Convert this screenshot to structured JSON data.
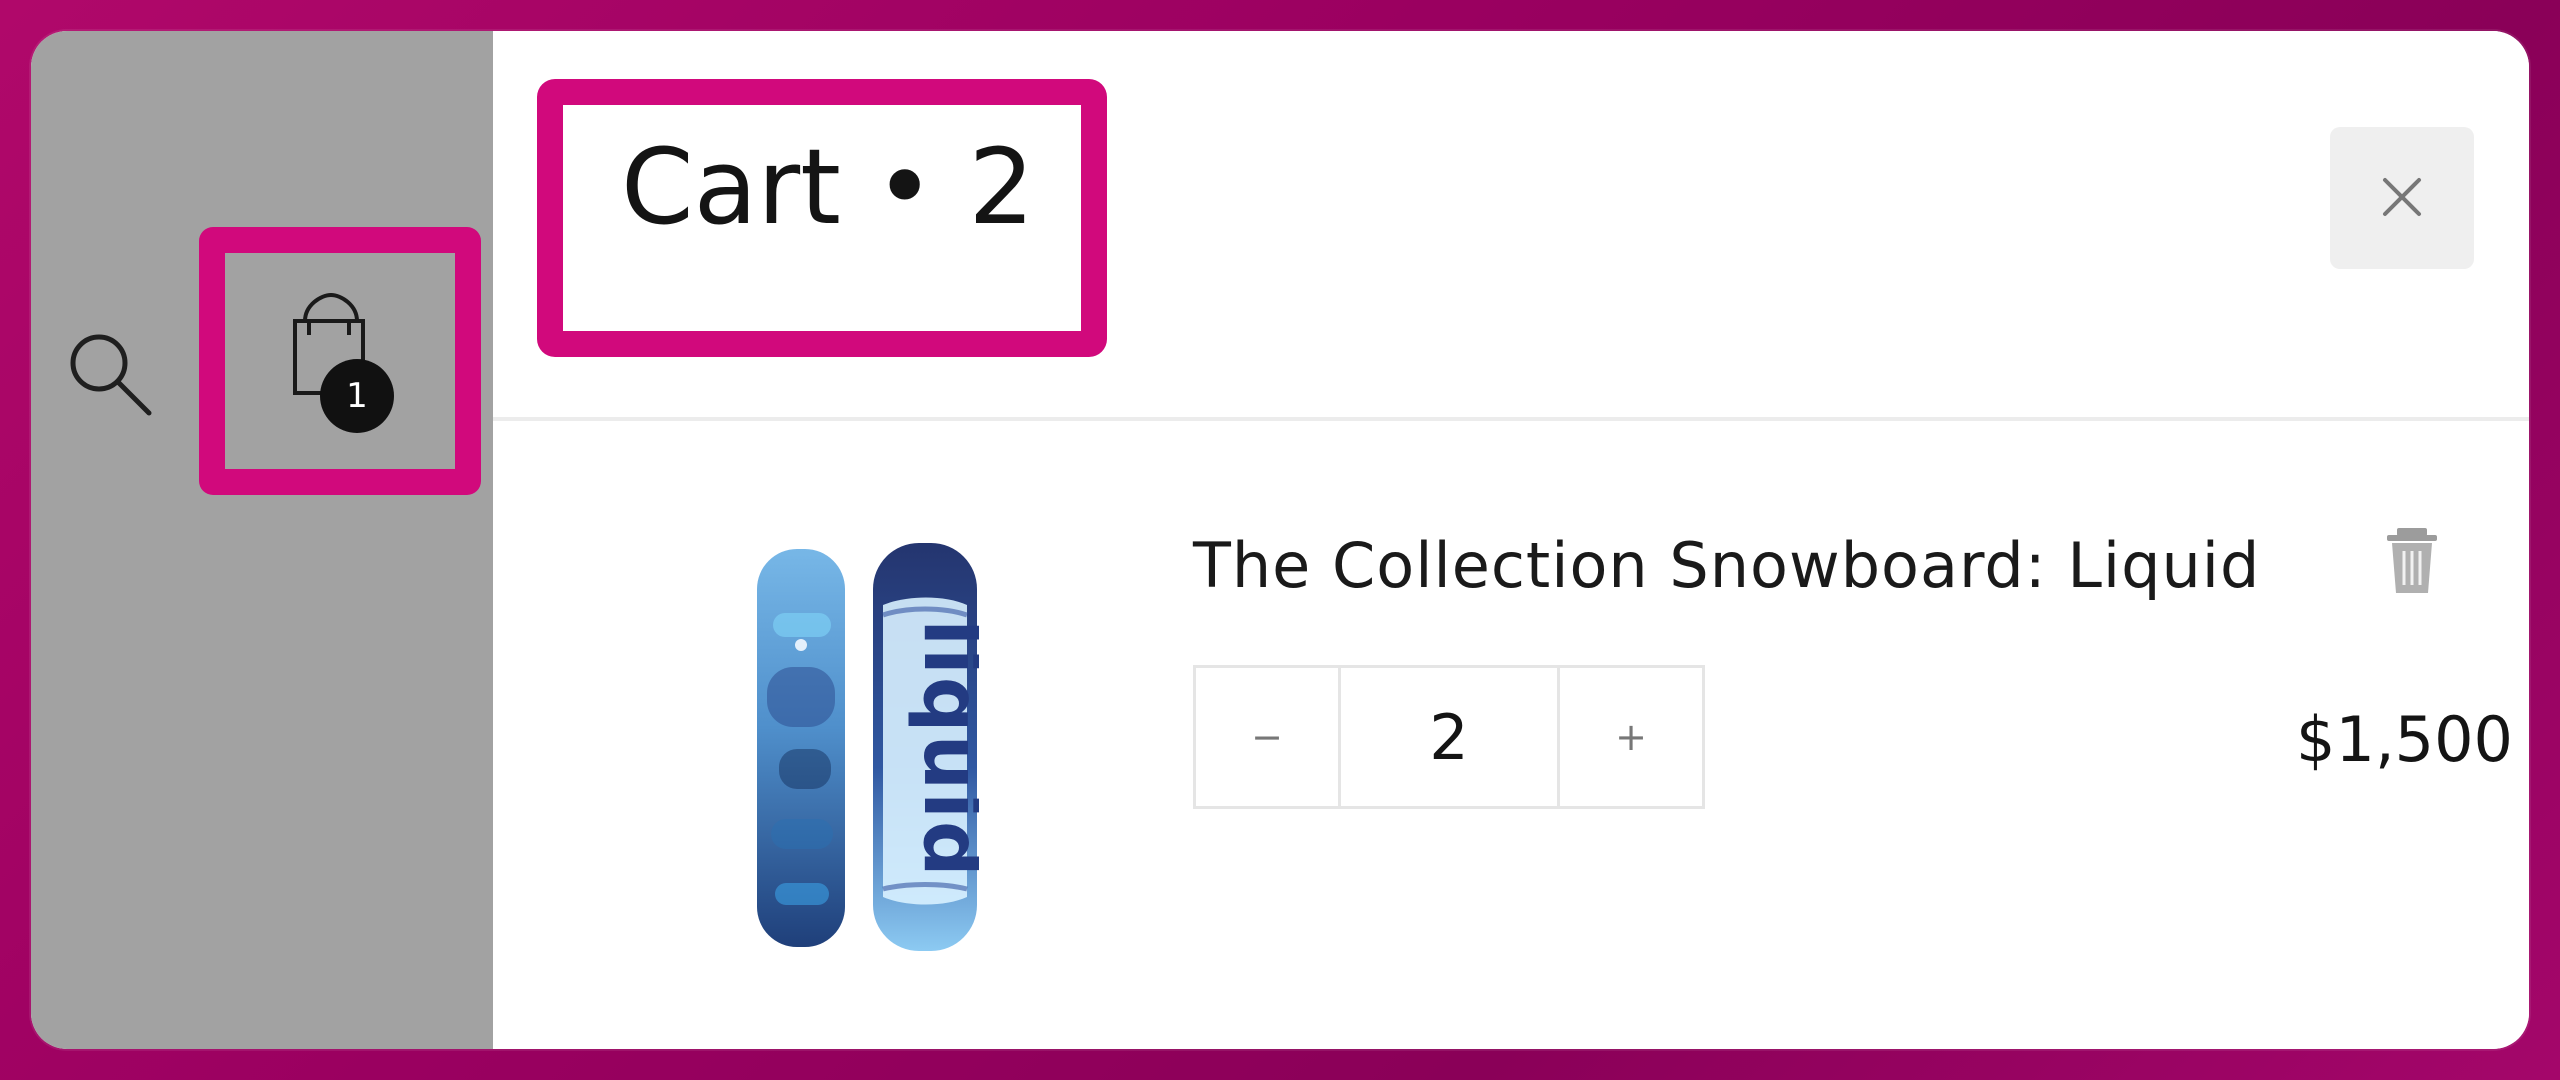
{
  "header": {
    "search_icon": "search-icon",
    "bag_icon": "shopping-bag-icon",
    "bag_badge_count": "1"
  },
  "cart": {
    "title": "Cart • 2",
    "close_icon": "close-icon",
    "close_label": "×"
  },
  "line_item": {
    "title": "The Collection Snowboard: Liquid",
    "image_text": "liquid",
    "quantity": "2",
    "decrease_label": "−",
    "increase_label": "+",
    "price": "$1,500",
    "delete_icon": "trash-icon"
  },
  "colors": {
    "highlight": "#d1097c",
    "background_gradient_start": "#b0086a",
    "background_gradient_end": "#8a0058",
    "left_panel": "#a2a2a2"
  }
}
